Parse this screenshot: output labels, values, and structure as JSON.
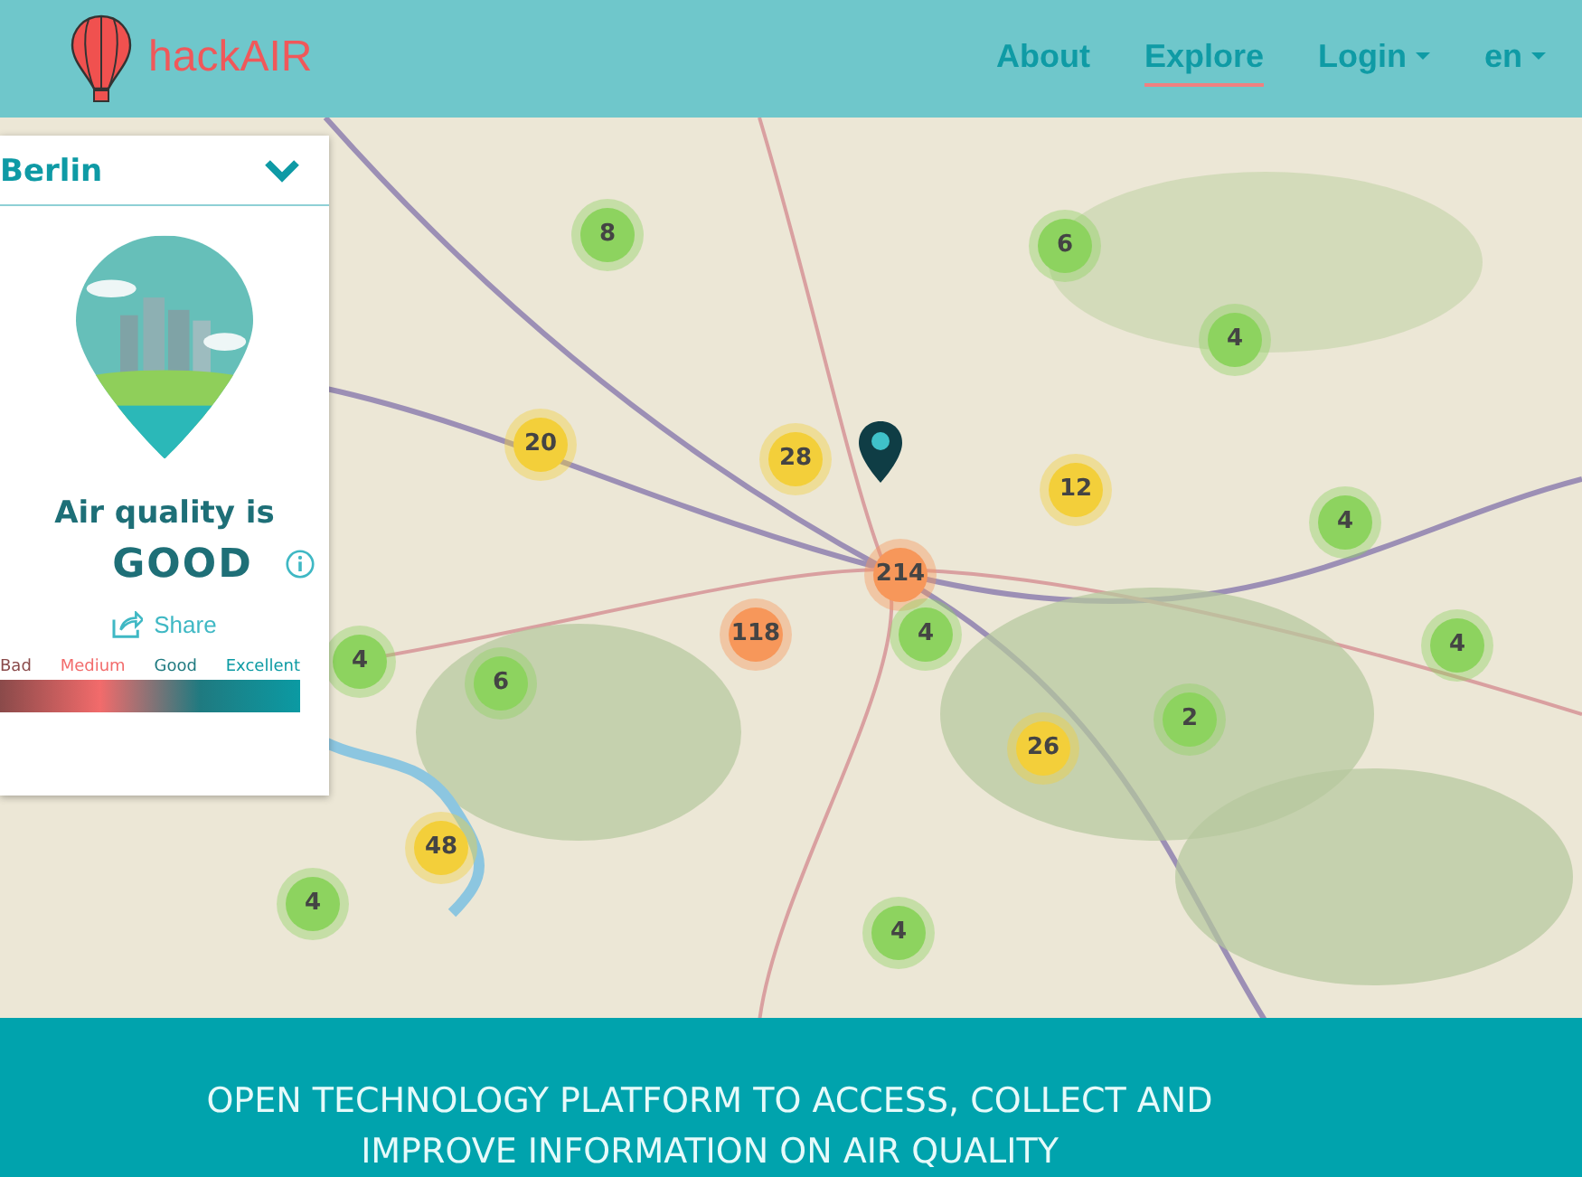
{
  "header": {
    "logo_text": "hackAIR",
    "nav": [
      {
        "label": "About",
        "selected": false,
        "dropdown": false
      },
      {
        "label": "Explore",
        "selected": true,
        "dropdown": false
      },
      {
        "label": "Login",
        "selected": false,
        "dropdown": true
      },
      {
        "label": "en",
        "selected": false,
        "dropdown": true
      }
    ]
  },
  "panel": {
    "location": "Berlin",
    "heading": "Air quality is",
    "rating": "GOOD",
    "share": "Share",
    "scale": [
      {
        "label": "Bad",
        "color": "#8a4a4a"
      },
      {
        "label": "Medium",
        "color": "#f26b6b"
      },
      {
        "label": "Good",
        "color": "#1f7a80"
      },
      {
        "label": "Excellent",
        "color": "#0b9aa3"
      }
    ]
  },
  "map": {
    "clusters": [
      {
        "count": "8",
        "color": "#8dd35f"
      },
      {
        "count": "6",
        "color": "#8dd35f"
      },
      {
        "count": "4",
        "color": "#8dd35f"
      },
      {
        "count": "20",
        "color": "#f3cf3a"
      },
      {
        "count": "28",
        "color": "#f3cf3a"
      },
      {
        "count": "12",
        "color": "#f3cf3a"
      },
      {
        "count": "4",
        "color": "#8dd35f"
      },
      {
        "count": "214",
        "color": "#f7975a"
      },
      {
        "count": "118",
        "color": "#f7975a"
      },
      {
        "count": "4",
        "color": "#8dd35f"
      },
      {
        "count": "4",
        "color": "#8dd35f"
      },
      {
        "count": "4",
        "color": "#8dd35f"
      },
      {
        "count": "6",
        "color": "#8dd35f"
      },
      {
        "count": "2",
        "color": "#8dd35f"
      },
      {
        "count": "26",
        "color": "#f3cf3a"
      },
      {
        "count": "48",
        "color": "#f3cf3a"
      },
      {
        "count": "4",
        "color": "#8dd35f"
      },
      {
        "count": "4",
        "color": "#8dd35f"
      }
    ]
  },
  "footer": {
    "headline": [
      "OPEN TECHNOLOGY PLATFORM TO ACCESS, COLLECT AND",
      "IMPROVE INFORMATION ON AIR QUALITY"
    ]
  }
}
